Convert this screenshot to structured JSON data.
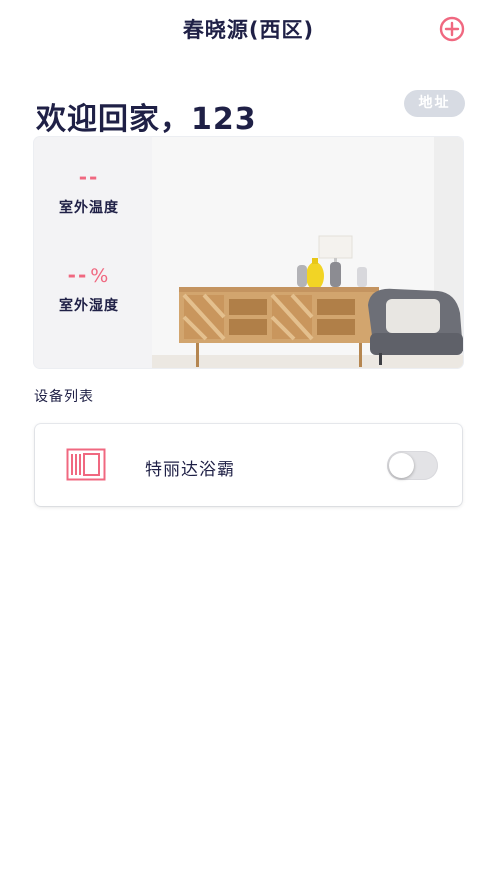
{
  "header": {
    "title": "春晓源(西区)",
    "add_icon": "plus-circle-icon"
  },
  "welcome": {
    "text": "欢迎回家，123"
  },
  "address_button": {
    "label": "地址"
  },
  "weather": {
    "temperature": {
      "value": "--",
      "label": "室外温度"
    },
    "humidity": {
      "value": "--",
      "unit": "%",
      "label": "室外湿度"
    }
  },
  "devices": {
    "section_title": "设备列表",
    "items": [
      {
        "name": "特丽达浴霸",
        "icon": "bath-heater-icon",
        "on": false
      }
    ]
  },
  "colors": {
    "accent": "#f06880",
    "text": "#1f2046",
    "badge": "#d7dbe3"
  }
}
